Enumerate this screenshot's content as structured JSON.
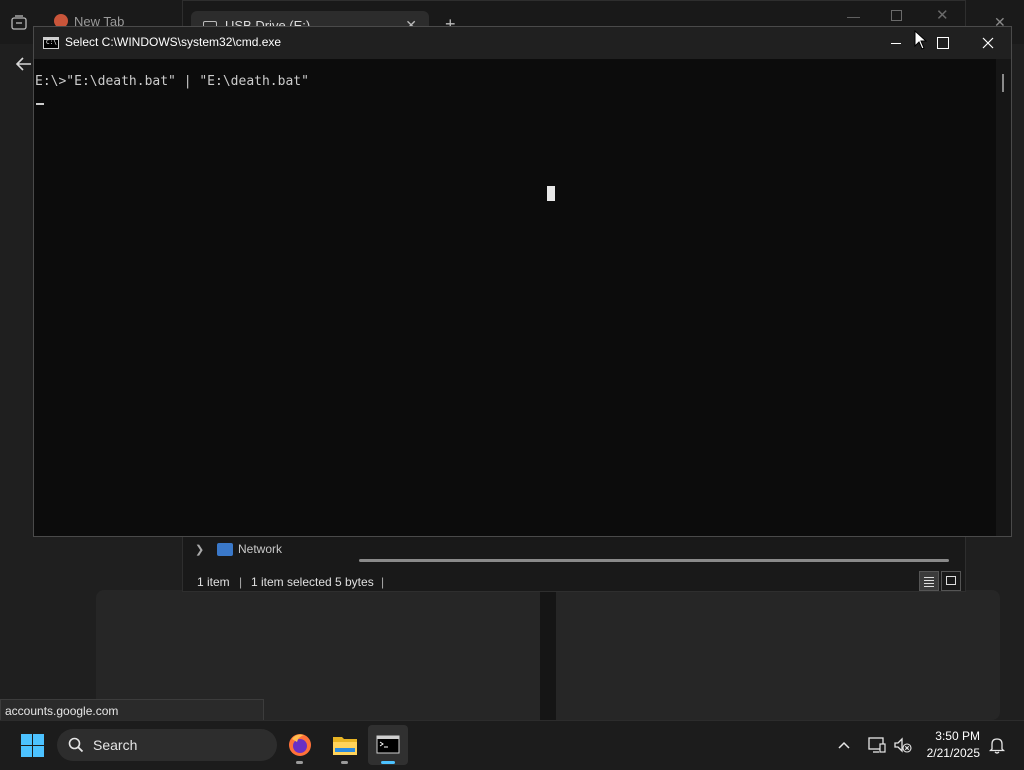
{
  "browser": {
    "tab_title": "New Tab",
    "status_url": "accounts.google.com"
  },
  "explorer": {
    "tab_title": "USB Drive (E:)",
    "nav_item": "Network",
    "status": {
      "items": "1 item",
      "selected": "1 item selected",
      "size": "5 bytes"
    }
  },
  "cmd": {
    "title": "Select C:\\WINDOWS\\system32\\cmd.exe",
    "icon_text": "C:\\",
    "command_line": "E:\\>\"E:\\death.bat\" | \"E:\\death.bat\""
  },
  "taskbar": {
    "search_label": "Search",
    "time": "3:50 PM",
    "date": "2/21/2025",
    "apps": [
      "firefox-icon",
      "file-explorer-icon",
      "terminal-icon"
    ]
  },
  "colors": {
    "accent": "#4cc2ff",
    "console_bg": "#0c0c0c",
    "console_text": "#cccccc",
    "taskbar_bg": "#1c1c1c"
  }
}
